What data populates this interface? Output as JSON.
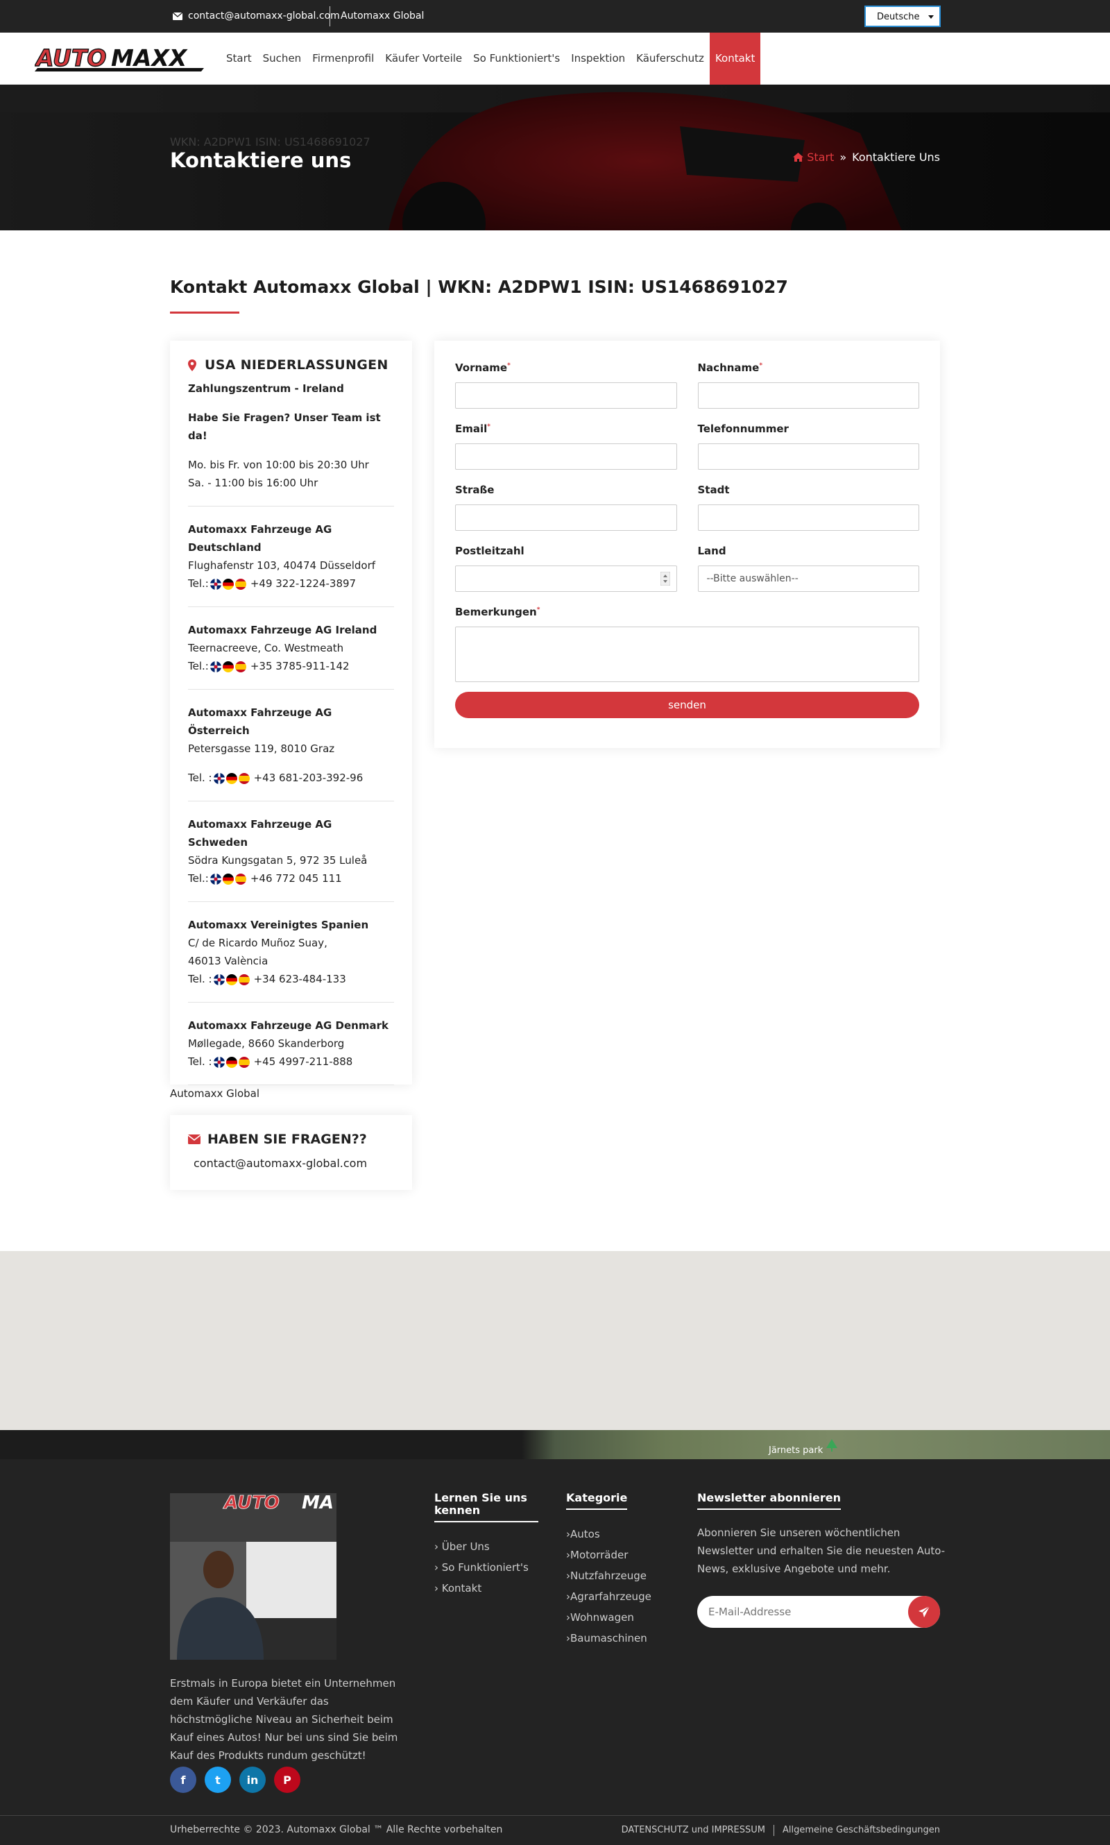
{
  "topbar": {
    "email": "contact@automaxx-global.com",
    "brand": "Automaxx Global",
    "language": "Deutsche"
  },
  "logo": {
    "text_red": "AUTO",
    "text_black": "MAXX"
  },
  "nav": {
    "items": [
      "Start",
      "Suchen",
      "Firmenprofil",
      "Käufer Vorteile",
      "So Funktioniert's",
      "Inspektion",
      "Käuferschutz",
      "Kontakt"
    ],
    "active": "Kontakt"
  },
  "hero": {
    "ghost": "WKN: A2DPW1 ISIN: US1468691027",
    "title": "Kontaktiere uns",
    "breadcrumb_home": "Start",
    "breadcrumb_current": "Kontaktiere Uns"
  },
  "section": {
    "heading": "Kontakt Automaxx Global | WKN: A2DPW1 ISIN: US1468691027"
  },
  "locations": {
    "title": "USA NIEDERLASSUNGEN",
    "subtitle": "Zahlungszentrum - Ireland",
    "question": "Habe Sie Fragen? Unser Team ist  da!",
    "hours1": "Mo. bis Fr. von 10:00 bis 20:30 Uhr",
    "hours2": "Sa. - 11:00 bis 16:00 Uhr",
    "offices": [
      {
        "name": "Automaxx Fahrzeuge AG Deutschland",
        "address": "Flughafenstr 103, 40474 Düsseldorf",
        "tel_label": "Tel.:",
        "tel": "+49 322-1224-3897"
      },
      {
        "name": "Automaxx Fahrzeuge AG Ireland",
        "address": "Teernacreeve, Co. Westmeath",
        "tel_label": "Tel.:",
        "tel": "+35 3785-911-142"
      },
      {
        "name": "Automaxx Fahrzeuge AG Österreich",
        "address": "Petersgasse 119, 8010 Graz",
        "tel_label": "Tel. :",
        "tel": "+43 681-203-392-96"
      },
      {
        "name": "Automaxx Fahrzeuge AG Schweden",
        "address": "Södra Kungsgatan 5, 972 35 Luleå",
        "tel_label": "Tel.:",
        "tel": "+46 772 045 111"
      },
      {
        "name": "Automaxx Vereinigtes Spanien",
        "address": "C/ de Ricardo Muñoz Suay, 46013 València",
        "tel_label": "Tel. :",
        "tel": "+34 623-484-133"
      },
      {
        "name": "Automaxx Fahrzeuge AG Denmark",
        "address": "Møllegade, 8660 Skanderborg",
        "tel_label": "Tel. :",
        "tel": "+45 4997-211-888"
      }
    ]
  },
  "form": {
    "first_name": "Vorname",
    "last_name": "Nachname",
    "email": "Email",
    "phone": "Telefonnummer",
    "street": "Straße",
    "city": "Stadt",
    "zip": "Postleitzahl",
    "country": "Land",
    "country_placeholder": "--Bitte auswählen--",
    "remarks": "Bemerkungen",
    "required_mark": "*",
    "submit": "senden"
  },
  "below_card": "Automaxx Global",
  "faq": {
    "title": "HABEN SIE FRAGEN??",
    "email": "contact@automaxx-global.com"
  },
  "map": {
    "label": "Järnets park"
  },
  "footer": {
    "photo_logo_red": "AUTO",
    "photo_logo_black": "MA",
    "about": "Erstmals in Europa bietet ein Unternehmen dem Käufer und Verkäufer das höchstmögliche Niveau an Sicherheit beim Kauf eines Autos! Nur bei uns sind Sie beim Kauf des Produkts rundum geschützt!",
    "social": [
      {
        "icon": "facebook-icon",
        "glyph": "f",
        "color": "#3b5998"
      },
      {
        "icon": "twitter-icon",
        "glyph": "t",
        "color": "#1da1f2"
      },
      {
        "icon": "linkedin-icon",
        "glyph": "in",
        "color": "#0e76a8"
      },
      {
        "icon": "pinterest-icon",
        "glyph": "P",
        "color": "#bd081c"
      }
    ],
    "learn": {
      "title": "Lernen Sie uns kennen",
      "items": [
        "Über Uns",
        "So Funktioniert's",
        "Kontakt"
      ]
    },
    "category": {
      "title": "Kategorie",
      "items": [
        "Autos",
        "Motorräder",
        "Nutzfahrzeuge",
        "Agrarfahrzeuge",
        "Wohnwagen",
        "Baumaschinen"
      ]
    },
    "newsletter": {
      "title": "Newsletter abonnieren",
      "text": "Abonnieren Sie unseren wöchentlichen Newsletter und erhalten Sie die neuesten Auto-News, exklusive Angebote und mehr.",
      "placeholder": "E-Mail-Addresse"
    },
    "copyright": "Urheberrechte © 2023. Automaxx Global ™ Alle Rechte vorbehalten",
    "privacy": "DATENSCHUTZ und IMPRESSUM",
    "terms": "Allgemeine Geschäftsbedingungen"
  },
  "colors": {
    "accent": "#d3373c",
    "dark": "#232323"
  }
}
